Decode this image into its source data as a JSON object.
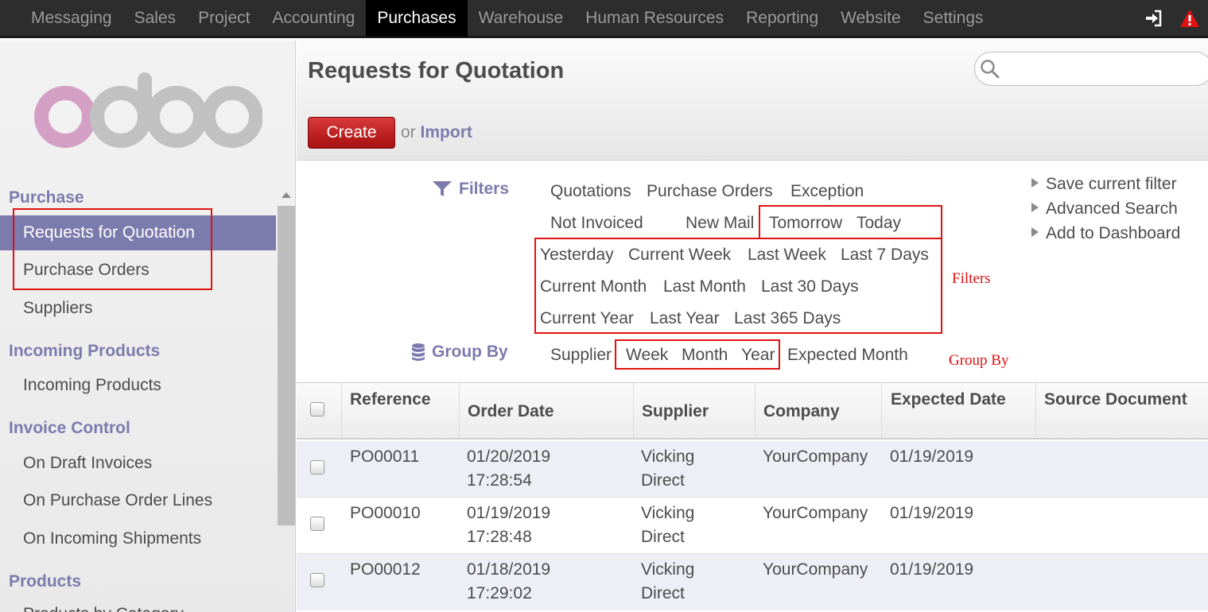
{
  "topnav": {
    "items": [
      "Messaging",
      "Sales",
      "Project",
      "Accounting",
      "Purchases",
      "Warehouse",
      "Human Resources",
      "Reporting",
      "Website",
      "Settings"
    ],
    "active": "Purchases",
    "icons": [
      "sign-in-icon",
      "warning-icon"
    ]
  },
  "sidebar": {
    "logo_text": "odoo",
    "sections": [
      {
        "title": "Purchase",
        "items": [
          "Requests for Quotation",
          "Purchase Orders",
          "Suppliers"
        ]
      },
      {
        "title": "Incoming Products",
        "items": [
          "Incoming Products"
        ]
      },
      {
        "title": "Invoice Control",
        "items": [
          "On Draft Invoices",
          "On Purchase Order Lines",
          "On Incoming Shipments"
        ]
      },
      {
        "title": "Products",
        "items": [
          "Products by Category"
        ]
      }
    ],
    "active_item": "Requests for Quotation"
  },
  "header": {
    "title": "Requests for Quotation",
    "search_placeholder": "",
    "create_label": "Create",
    "or_label": "or",
    "import_label": "Import"
  },
  "filters": {
    "title": "Filters",
    "options": [
      "Quotations",
      "Purchase Orders",
      "Exception",
      "Not Invoiced",
      "New Mail",
      "Tomorrow",
      "Today",
      "Yesterday",
      "Current Week",
      "Last Week",
      "Last 7 Days",
      "Current Month",
      "Last Month",
      "Last 30 Days",
      "Current Year",
      "Last Year",
      "Last 365 Days"
    ]
  },
  "groupby": {
    "title": "Group By",
    "options": [
      "Supplier",
      "Week",
      "Month",
      "Year",
      "Expected Month"
    ]
  },
  "side_actions": [
    "Save current filter",
    "Advanced Search",
    "Add to Dashboard"
  ],
  "annotations": {
    "filters": "Filters",
    "groupby": "Group By"
  },
  "table": {
    "columns": [
      "Reference",
      "Order Date",
      "Supplier",
      "Company",
      "Expected Date",
      "Source Document"
    ],
    "rows": [
      {
        "reference": "PO00011",
        "order_date": "01/20/2019\n17:28:54",
        "supplier": "Vicking\nDirect",
        "company": "YourCompany",
        "expected_date": "01/19/2019",
        "source": ""
      },
      {
        "reference": "PO00010",
        "order_date": "01/19/2019\n17:28:48",
        "supplier": "Vicking\nDirect",
        "company": "YourCompany",
        "expected_date": "01/19/2019",
        "source": ""
      },
      {
        "reference": "PO00012",
        "order_date": "01/18/2019\n17:29:02",
        "supplier": "Vicking\nDirect",
        "company": "YourCompany",
        "expected_date": "01/19/2019",
        "source": ""
      }
    ]
  },
  "colors": {
    "accent": "#7c7bad",
    "create": "#c21b1b",
    "annotation": "#e21111",
    "topbar": "#2d2d2d"
  }
}
